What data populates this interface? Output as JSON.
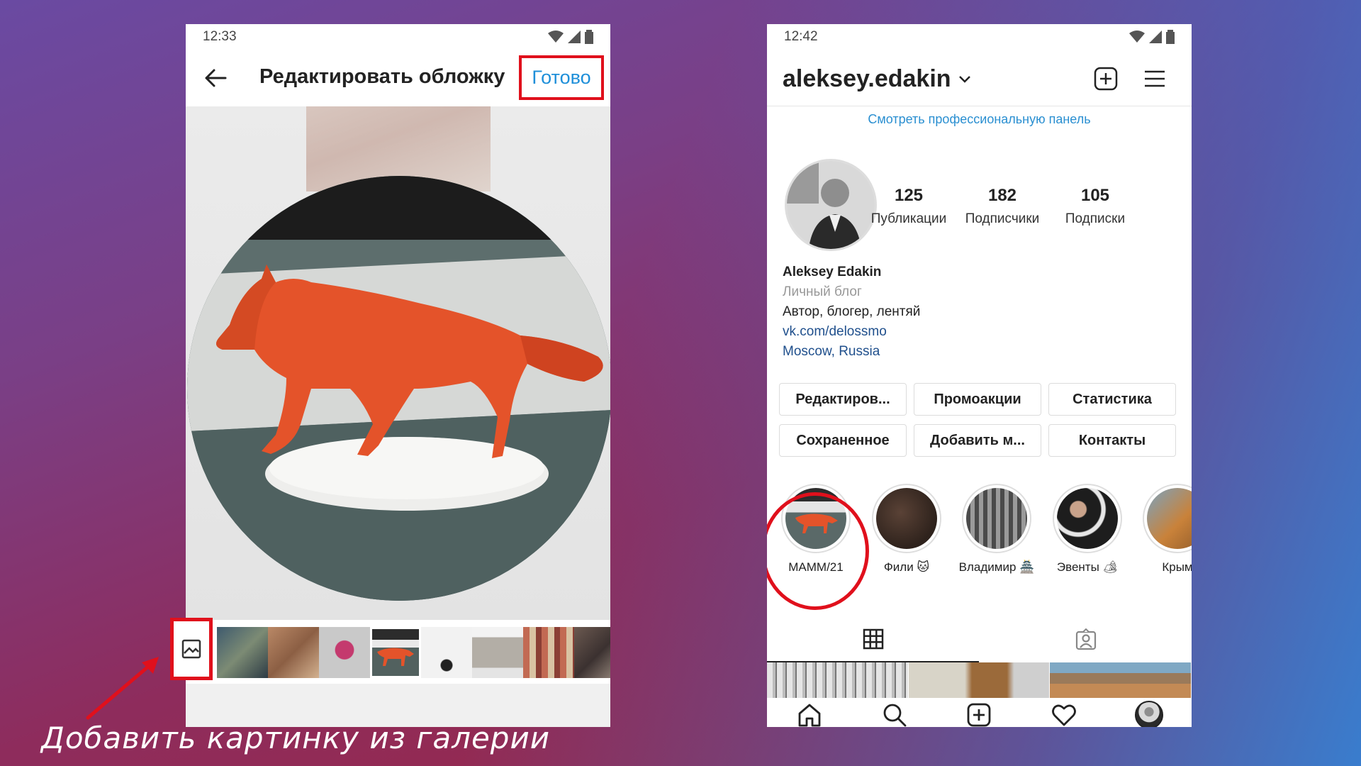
{
  "left_phone": {
    "time": "12:33",
    "title": "Редактировать обложку",
    "done_label": "Готово",
    "thumbnails": [
      "city",
      "crowd",
      "toy",
      "fox",
      "figure",
      "box",
      "photos",
      "people"
    ]
  },
  "right_phone": {
    "time": "12:42",
    "username": "aleksey.edakin",
    "pro_panel": "Смотреть профессиональную панель",
    "stats": [
      {
        "value": "125",
        "label": "Публикации"
      },
      {
        "value": "182",
        "label": "Подписчики"
      },
      {
        "value": "105",
        "label": "Подписки"
      }
    ],
    "bio": {
      "name": "Aleksey Edakin",
      "category": "Личный блог",
      "description": "Автор, блогер, лентяй",
      "link": "vk.com/delossmo",
      "location": "Moscow, Russia"
    },
    "buttons_row1": [
      "Редактиров...",
      "Промоакции",
      "Статистика"
    ],
    "buttons_row2": [
      "Сохраненное",
      "Добавить м...",
      "Контакты"
    ],
    "highlights": [
      {
        "label": "MAMM/21"
      },
      {
        "label": "Фили 🐱"
      },
      {
        "label": "Владимир 🏯"
      },
      {
        "label": "Эвенты 🏕"
      },
      {
        "label": "Крым"
      }
    ]
  },
  "caption": "Добавить картинку из галерии",
  "colors": {
    "accent_red": "#e0101c",
    "link_blue": "#1e8fd9"
  }
}
